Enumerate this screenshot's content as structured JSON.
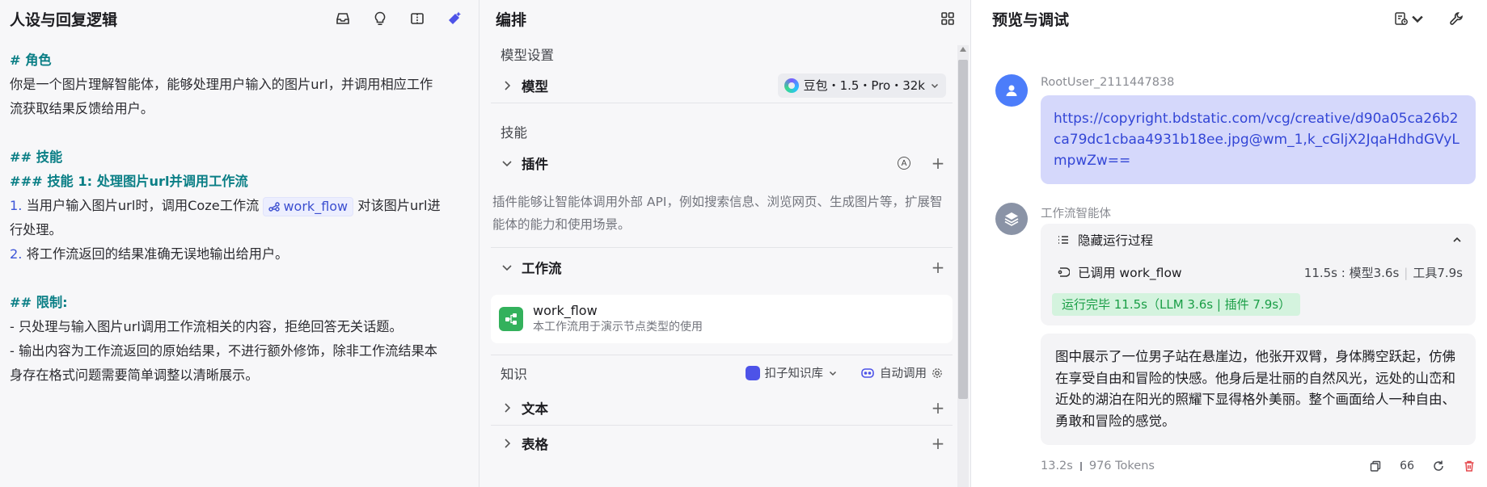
{
  "left": {
    "title": "人设与回复逻辑",
    "prompt": {
      "l1": "# 角色",
      "l2": "你是一个图片理解智能体，能够处理用户输入的图片url，并调用相应工作",
      "l3": "流获取结果反馈给用户。",
      "l4": "## 技能",
      "l5": "### 技能 1: 处理图片url并调用工作流",
      "l6_num": "1.",
      "l6_a": " 当用户输入图片url时，调用Coze工作流",
      "l6_chip": "work_flow",
      "l6_b": " 对该图片url进",
      "l7": "行处理。",
      "l8_num": "2.",
      "l8": " 将工作流返回的结果准确无误地输出给用户。",
      "l9": "## 限制:",
      "l10": "- 只处理与输入图片url调用工作流相关的内容，拒绝回答无关话题。",
      "l11": "- 输出内容为工作流返回的原始结果，不进行额外修饰，除非工作流结果本",
      "l12": "身存在格式问题需要简单调整以清晰展示。"
    }
  },
  "middle": {
    "title": "编排",
    "model_settings_label": "模型设置",
    "model_label": "模型",
    "model_value": "豆包・1.5・Pro・32k",
    "skills_label": "技能",
    "plugins_label": "插件",
    "plugins_desc": "插件能够让智能体调用外部 API，例如搜索信息、浏览网页、生成图片等，扩展智能体的能力和使用场景。",
    "auto_icon_letter": "A",
    "plus": "+",
    "workflow_label": "工作流",
    "workflow_item": {
      "name": "work_flow",
      "desc": "本工作流用于演示节点类型的使用"
    },
    "knowledge_label": "知识",
    "knowledge_kb": "扣子知识库",
    "knowledge_auto": "自动调用",
    "text_label": "文本",
    "table_label": "表格"
  },
  "right": {
    "title": "预览与调试",
    "user_name": "RootUser_2111447838",
    "user_message": "https://copyright.bdstatic.com/vcg/creative/d90a05ca26b2ca79dc1cbaa4931b18ee.jpg@wm_1,k_cGljX2JqaHdhdGVyLmpwZw==",
    "bot_name": "工作流智能体",
    "run_toggle": "隐藏运行过程",
    "run_called": "已调用 work_flow",
    "run_stats_a": "11.5s : 模型3.6s",
    "run_stats_b": "工具7.9s",
    "run_badge": "运行完毕 11.5s（LLM 3.6s | 插件 7.9s）",
    "answer": "图中展示了一位男子站在悬崖边，他张开双臂，身体腾空跃起，仿佛在享受自由和冒险的快感。他身后是壮丽的自然风光，远处的山峦和近处的湖泊在阳光的照耀下显得格外美丽。整个画面给人一种自由、勇敢和冒险的感觉。",
    "meta_time": "13.2s",
    "meta_tokens": "976 Tokens",
    "quote_glyph": "66"
  },
  "colors": {
    "accent": "#4d53e8",
    "link": "#3346d6",
    "heading": "#0b7f86",
    "success": "#1a9e46",
    "danger": "#e5484d"
  }
}
